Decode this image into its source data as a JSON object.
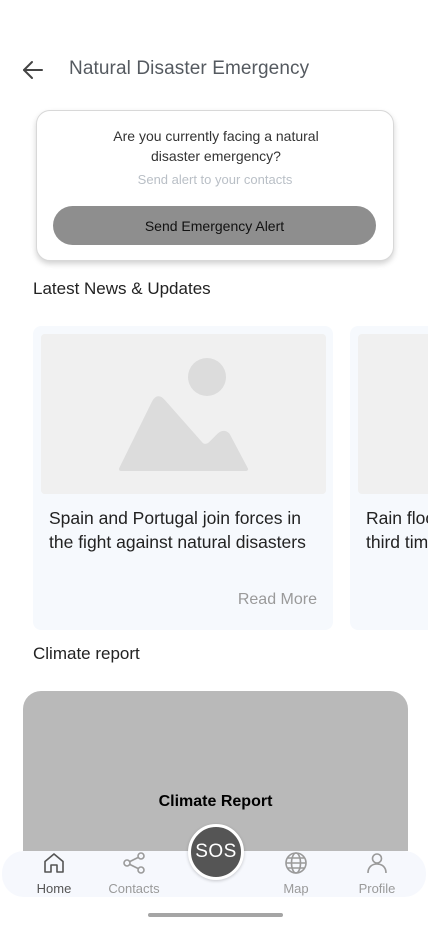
{
  "header": {
    "title": "Natural Disaster Emergency",
    "back_icon": "arrow-left-icon"
  },
  "alert": {
    "question": "Are you currently facing a natural disaster emergency?",
    "subtitle": "Send alert to your contacts",
    "button_label": "Send Emergency Alert"
  },
  "news": {
    "section_title": "Latest News & Updates",
    "items": [
      {
        "headline_line1": "Spain and Portugal join forces in",
        "headline_line2": "the fight against natural disasters",
        "read_more": "Read More"
      },
      {
        "headline_line1": "Rain floo",
        "headline_line2": "third tim"
      }
    ]
  },
  "climate": {
    "section_title": "Climate report",
    "card_label": "Climate Report"
  },
  "nav": {
    "items": [
      {
        "label": "Home",
        "icon": "home-icon"
      },
      {
        "label": "Contacts",
        "icon": "share-icon"
      },
      {
        "label": "Map",
        "icon": "globe-icon"
      },
      {
        "label": "Profile",
        "icon": "user-icon"
      }
    ],
    "sos_label": "SOS"
  },
  "colors": {
    "alert_button": "#8e8e8e",
    "sos_button": "#555555",
    "news_card_bg": "#f6f9fd",
    "climate_card_bg": "#b9b9b9"
  }
}
